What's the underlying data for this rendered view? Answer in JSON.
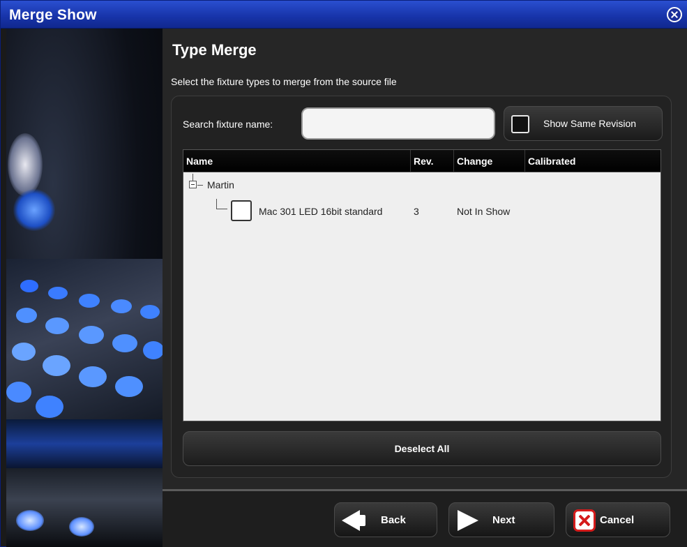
{
  "window": {
    "title": "Merge Show"
  },
  "page": {
    "heading": "Type Merge",
    "subtitle": "Select the fixture types to merge from the source file"
  },
  "search": {
    "label": "Search fixture name:",
    "value": "",
    "placeholder": ""
  },
  "same_revision": {
    "label": "Show Same Revision",
    "checked": false
  },
  "table": {
    "columns": [
      "Name",
      "Rev.",
      "Change",
      "Calibrated"
    ],
    "groups": [
      {
        "name": "Martin",
        "expanded": true,
        "rows": [
          {
            "name": "Mac 301 LED 16bit standard",
            "rev": "3",
            "change": "Not In Show",
            "calibrated": "",
            "checked": false
          }
        ]
      }
    ]
  },
  "deselect_all": {
    "label": "Deselect All"
  },
  "footer": {
    "back_label": "Back",
    "next_label": "Next",
    "cancel_label": "Cancel"
  },
  "icons": {
    "close": "close-circle-icon",
    "back": "arrow-left-icon",
    "next": "arrow-right-icon",
    "cancel": "cancel-x-icon"
  },
  "colors": {
    "titlebar": "#1733a8",
    "cancel_red": "#d51b1b",
    "panel": "#262626"
  }
}
